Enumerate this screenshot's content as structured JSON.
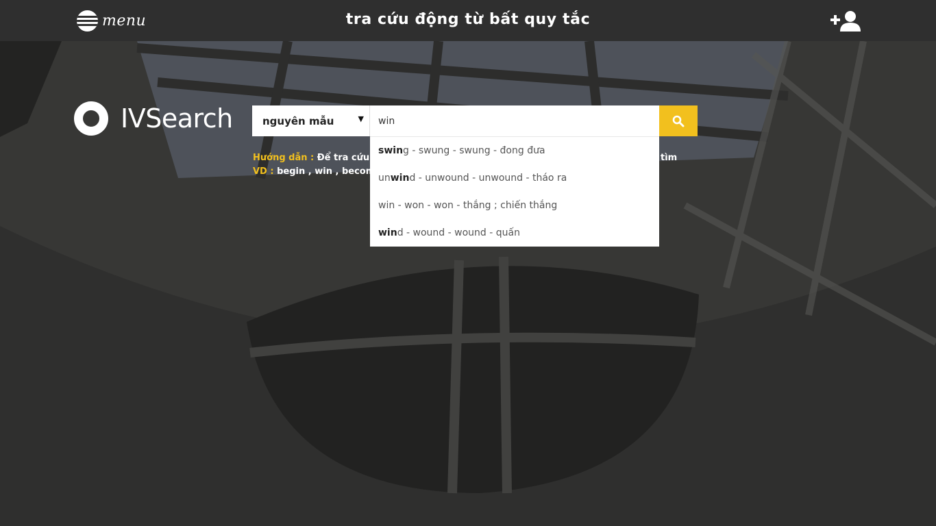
{
  "header": {
    "menu_label": "menu",
    "title": "tra cứu động từ bất quy tắc"
  },
  "logo": {
    "text": "IVSearch"
  },
  "search": {
    "mode_selected": "nguyên mẫu",
    "query": "win",
    "button_icon": "search-icon"
  },
  "hints": {
    "guide_key": "Hướng dẫn :",
    "guide_text": "Để tra cứu đ",
    "guide_tail": "tìm",
    "example_key": "VD :",
    "example_text": "begin , win , become"
  },
  "suggestions": [
    {
      "match": "swin",
      "rest": "g - swung - swung - đong đưa"
    },
    {
      "pre": "un",
      "match": "win",
      "rest": "d - unwound - unwound - tháo ra"
    },
    {
      "pre": "",
      "match": "",
      "rest": "win - won - won - thắng ; chiến thắng"
    },
    {
      "match": "win",
      "rest": "d - wound - wound - quấn"
    }
  ],
  "colors": {
    "accent": "#f2c01e",
    "topbar": "#2f2f2f"
  }
}
